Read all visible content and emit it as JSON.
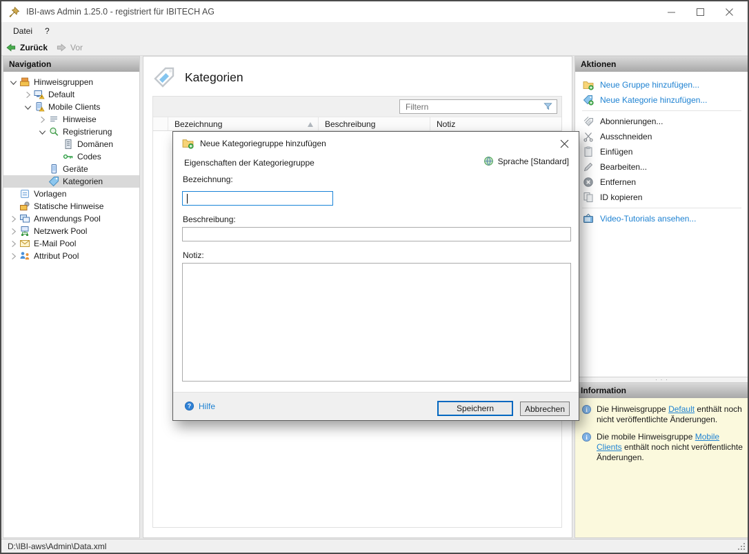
{
  "window": {
    "title": "IBI-aws Admin 1.25.0 - registriert für IBITECH AG",
    "controls": [
      "minimize-icon",
      "maximize-icon",
      "close-icon"
    ]
  },
  "menu": {
    "items": [
      "Datei",
      "?"
    ]
  },
  "toolbar": {
    "back_label": "Zurück",
    "forward_label": "Vor",
    "back_enabled": true,
    "forward_enabled": false
  },
  "navigation": {
    "header": "Navigation",
    "tree": [
      {
        "label": "Hinweisgruppen",
        "level": 0,
        "chevron": "expanded",
        "icon": "notice-groups",
        "selected": false
      },
      {
        "label": "Default",
        "level": 1,
        "chevron": "collapsed",
        "icon": "monitor-warning",
        "selected": false
      },
      {
        "label": "Mobile Clients",
        "level": 1,
        "chevron": "expanded",
        "icon": "mobile-warning",
        "selected": false
      },
      {
        "label": "Hinweise",
        "level": 2,
        "chevron": "collapsed",
        "icon": "hints",
        "selected": false
      },
      {
        "label": "Registrierung",
        "level": 2,
        "chevron": "expanded",
        "icon": "registration",
        "selected": false
      },
      {
        "label": "Domänen",
        "level": 3,
        "chevron": "none",
        "icon": "domains",
        "selected": false
      },
      {
        "label": "Codes",
        "level": 3,
        "chevron": "none",
        "icon": "key",
        "selected": false
      },
      {
        "label": "Geräte",
        "level": 2,
        "chevron": "none",
        "icon": "device",
        "selected": false
      },
      {
        "label": "Kategorien",
        "level": 2,
        "chevron": "none",
        "icon": "tag",
        "selected": true
      },
      {
        "label": "Vorlagen",
        "level": 0,
        "chevron": "none",
        "icon": "templates",
        "selected": false
      },
      {
        "label": "Statische Hinweise",
        "level": 0,
        "chevron": "none",
        "icon": "static-hints",
        "selected": false
      },
      {
        "label": "Anwendungs Pool",
        "level": 0,
        "chevron": "collapsed",
        "icon": "app-pool",
        "selected": false
      },
      {
        "label": "Netzwerk Pool",
        "level": 0,
        "chevron": "collapsed",
        "icon": "network-pool",
        "selected": false
      },
      {
        "label": "E-Mail Pool",
        "level": 0,
        "chevron": "collapsed",
        "icon": "mail-pool",
        "selected": false
      },
      {
        "label": "Attribut Pool",
        "level": 0,
        "chevron": "collapsed",
        "icon": "attribute-pool",
        "selected": false
      }
    ]
  },
  "content": {
    "title": "Kategorien",
    "filter_placeholder": "Filtern",
    "table": {
      "columns": [
        "Bezeichnung",
        "Beschreibung",
        "Notiz"
      ],
      "sorted_column": "Bezeichnung",
      "sort_direction": "asc",
      "rows": []
    }
  },
  "dialog": {
    "title": "Neue Kategoriegruppe hinzufügen",
    "section_label": "Eigenschaften der Kategoriegruppe",
    "language_label": "Sprache [Standard]",
    "fields": [
      {
        "label": "Bezeichnung:",
        "value": "",
        "focused": true
      },
      {
        "label": "Beschreibung:",
        "value": "",
        "focused": false
      },
      {
        "label": "Notiz:",
        "value": "",
        "focused": false
      }
    ],
    "help_label": "Hilfe",
    "save_label": "Speichern",
    "cancel_label": "Abbrechen"
  },
  "actions": {
    "header": "Aktionen",
    "items": [
      {
        "label": "Neue Gruppe hinzufügen...",
        "type": "link",
        "icon": "folder-add",
        "separator_before": false
      },
      {
        "label": "Neue Kategorie hinzufügen...",
        "type": "link",
        "icon": "tag-add",
        "separator_before": false
      },
      {
        "label": "Abonnierungen...",
        "type": "normal",
        "icon": "tags",
        "separator_before": true
      },
      {
        "label": "Ausschneiden",
        "type": "normal",
        "icon": "scissors",
        "separator_before": false
      },
      {
        "label": "Einfügen",
        "type": "normal",
        "icon": "paste",
        "separator_before": false
      },
      {
        "label": "Bearbeiten...",
        "type": "normal",
        "icon": "pencil",
        "separator_before": false
      },
      {
        "label": "Entfernen",
        "type": "normal",
        "icon": "remove",
        "separator_before": false
      },
      {
        "label": "ID kopieren",
        "type": "normal",
        "icon": "copy",
        "separator_before": false
      },
      {
        "label": "Video-Tutorials ansehen...",
        "type": "link",
        "icon": "tv",
        "separator_before": true
      }
    ]
  },
  "information": {
    "header": "Information",
    "items": [
      {
        "prefix": "Die Hinweisgruppe ",
        "link": "Default",
        "suffix": " enthält noch nicht veröffentlichte Änderungen."
      },
      {
        "prefix": "Die mobile Hinweisgruppe ",
        "link": "Mobile Clients",
        "suffix": " enthält noch nicht veröffentlichte Änderungen."
      }
    ]
  },
  "statusbar": {
    "file_path": "D:\\IBI-aws\\Admin\\Data.xml"
  },
  "colors": {
    "link_blue": "#1e82d2",
    "focus_blue": "#1883d7",
    "save_border_blue": "#0067c0",
    "selection_gray": "#d9d9d9",
    "info_background": "#fbf9dd",
    "panel_header_gray": "#a8a8a8"
  }
}
